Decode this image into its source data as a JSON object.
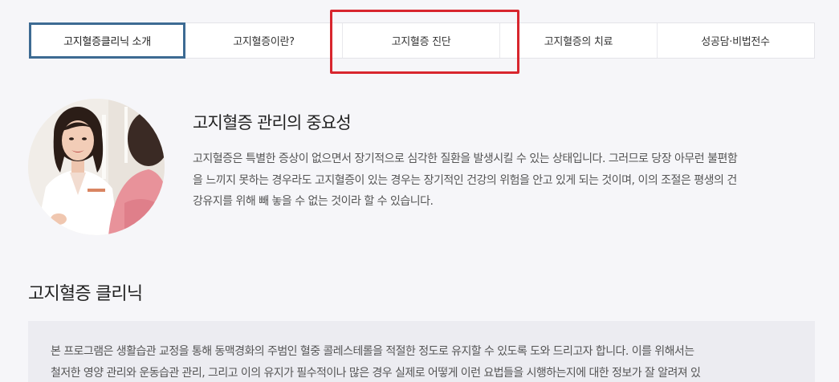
{
  "tabs": [
    {
      "label": "고지혈증클리닉 소개",
      "active": true
    },
    {
      "label": "고지혈증이란?",
      "active": false
    },
    {
      "label": "고지혈증 진단",
      "active": false
    },
    {
      "label": "고지혈증의 치료",
      "active": false
    },
    {
      "label": "성공담·비법전수",
      "active": false
    }
  ],
  "colors": {
    "active_tab_border": "#3d6b93",
    "highlight_box": "#d8262e",
    "background": "#f6f6f9"
  },
  "intro": {
    "title": "고지혈증 관리의 중요성",
    "lines": [
      "고지혈증은 특별한 증상이 없으면서 장기적으로 심각한 질환을 발생시킬 수 있는 상태입니다. 그러므로 당장 아무런 불편함",
      "을 느끼지 못하는 경우라도 고지혈증이 있는 경우는 장기적인 건강의 위험을 안고 있게 되는 것이며, 이의 조절은 평생의 건",
      "강유지를 위해 빼 놓을 수 없는 것이라 할 수 있습니다."
    ]
  },
  "clinic": {
    "title": "고지혈증 클리닉",
    "lines": [
      "본 프로그램은 생활습관 교정을 통해 동맥경화의 주범인 혈중 콜레스테롤을 적절한 정도로 유지할 수 있도록 도와 드리고자 합니다. 이를 위해서는",
      "철저한 영양 관리와 운동습관 관리, 그리고 이의 유지가 필수적이나 많은 경우 실제로 어떻게 이런 요법들을 시행하는지에 대한 정보가 잘 알려져 있"
    ]
  }
}
